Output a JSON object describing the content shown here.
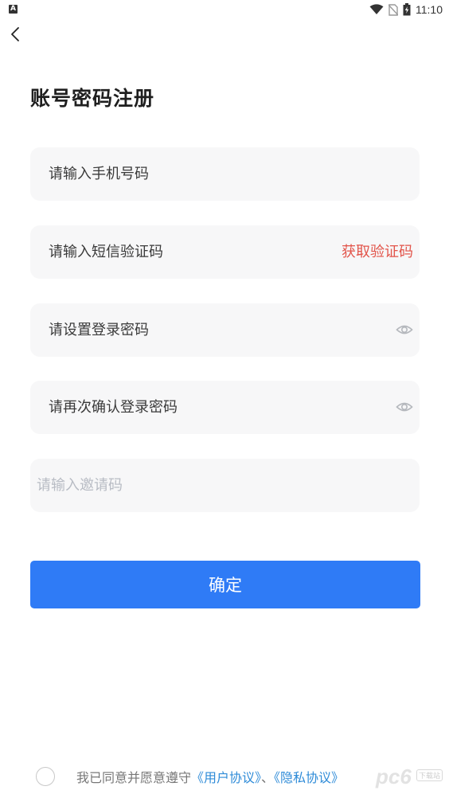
{
  "status_bar": {
    "notification_letter": "A",
    "time": "11:10",
    "icons": [
      "wifi-icon",
      "no-sim-icon",
      "battery-charging-icon"
    ]
  },
  "header": {
    "back_icon": "chevron-left-icon",
    "title": "账号密码注册"
  },
  "form": {
    "phone_placeholder": "请输入手机号码",
    "sms_placeholder": "请输入短信验证码",
    "get_code_label": "获取验证码",
    "password_placeholder": "请设置登录密码",
    "confirm_password_placeholder": "请再次确认登录密码",
    "invite_placeholder": "请输入邀请码",
    "eye_icon": "eye-icon"
  },
  "confirm_label": "确定",
  "agreement": {
    "prefix": "我已同意并愿意遵守",
    "user_agreement": "《用户协议》",
    "separator": "、",
    "privacy_policy": "《隐私协议》"
  },
  "watermark": {
    "letters": "pc6",
    "badge": "下载站"
  },
  "colors": {
    "primary": "#2f7bf6",
    "get_code": "#e2544a",
    "link": "#2e8bd8",
    "field_bg": "#f7f7f8"
  }
}
